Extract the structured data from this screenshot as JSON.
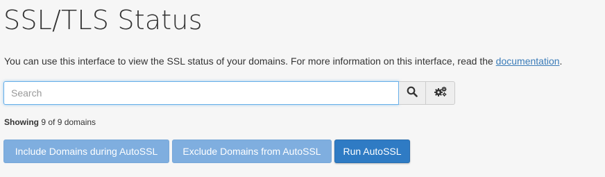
{
  "page": {
    "title": "SSL/TLS Status",
    "description_prefix": "You can use this interface to view the SSL status of your domains. For more information on this interface, read the ",
    "description_link": "documentation",
    "description_suffix": "."
  },
  "search": {
    "placeholder": "Search",
    "value": "",
    "search_icon": "search-icon",
    "settings_icon": "settings-gears-icon"
  },
  "status": {
    "showing_label": "Showing",
    "showing_text": "9 of 9 domains"
  },
  "actions": {
    "include_label": "Include Domains during AutoSSL",
    "exclude_label": "Exclude Domains from AutoSSL",
    "run_label": "Run AutoSSL"
  },
  "colors": {
    "link": "#3a7bb8",
    "primary_button": "#2f7bc4",
    "disabled_button": "#7faedf",
    "focus_border": "#66afe9"
  }
}
